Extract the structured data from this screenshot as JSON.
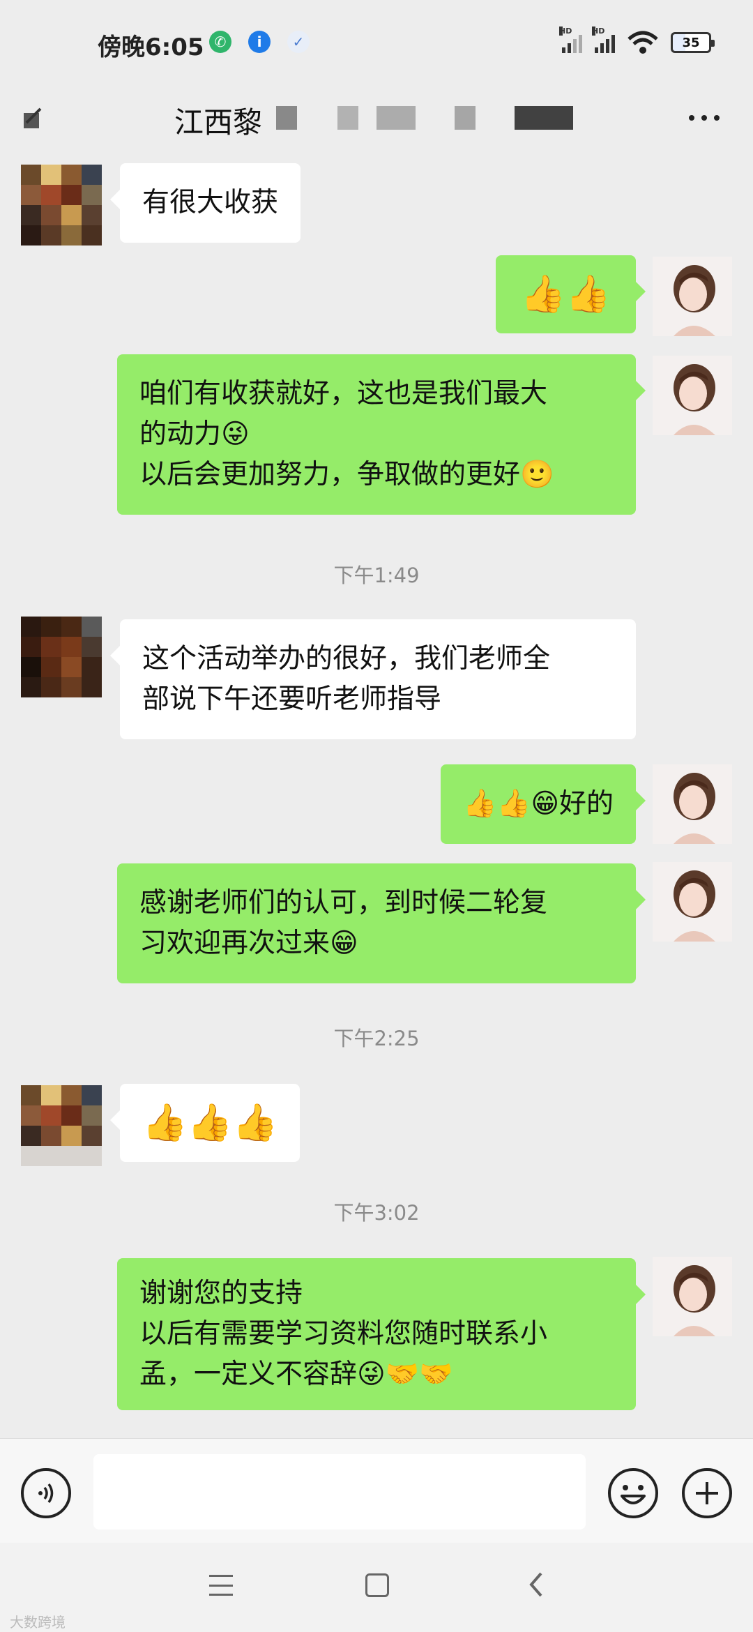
{
  "status_bar": {
    "time": "傍晚6:05",
    "battery": "35",
    "signal_label": "HD"
  },
  "header": {
    "title": "江西黎"
  },
  "messages": [
    {
      "side": "in",
      "text": "有很大收获"
    },
    {
      "side": "out",
      "emojis": "👍👍"
    },
    {
      "side": "out",
      "text": "咱们有收获就好，这也是我们最大\n的动力😜\n以后会更加努力，争取做的更好🙂"
    },
    {
      "side": "time",
      "text": "下午1:49"
    },
    {
      "side": "in",
      "text": "这个活动举办的很好，我们老师全\n部说下午还要听老师指导"
    },
    {
      "side": "out",
      "text": "👍👍😁好的"
    },
    {
      "side": "out",
      "text": "感谢老师们的认可，到时候二轮复\n习欢迎再次过来😁"
    },
    {
      "side": "time",
      "text": "下午2:25"
    },
    {
      "side": "in",
      "emojis": "👍👍👍"
    },
    {
      "side": "time",
      "text": "下午3:02"
    },
    {
      "side": "out",
      "text": "谢谢您的支持\n以后有需要学习资料您随时联系小\n孟，一定义不容辞😜🤝🤝"
    }
  ],
  "watermark": "大数跨境",
  "icons": {
    "back": "back-icon",
    "more": "more-icon",
    "voice": "voice-icon",
    "emoji": "emoji-icon",
    "plus": "plus-icon",
    "nav_menu": "menu-icon",
    "nav_home": "home-icon",
    "nav_back": "nav-back-icon"
  },
  "colors": {
    "outgoing_bubble": "#95ec69",
    "incoming_bubble": "#ffffff",
    "background": "#ededed"
  }
}
